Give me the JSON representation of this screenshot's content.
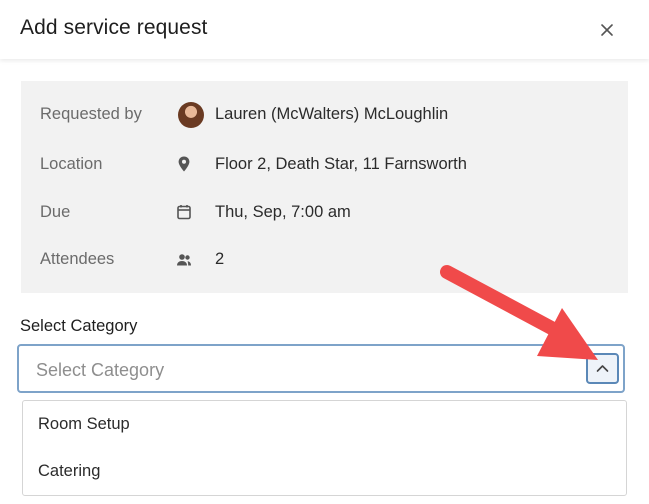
{
  "dialog": {
    "title": "Add service request"
  },
  "details": {
    "requested_by": {
      "label": "Requested by",
      "value": "Lauren (McWalters) McLoughlin"
    },
    "location": {
      "label": "Location",
      "value": "Floor 2, Death Star, 11 Farnsworth",
      "icon": "location-pin-icon"
    },
    "due": {
      "label": "Due",
      "value": "Thu, Sep, 7:00 am",
      "icon": "calendar-icon"
    },
    "attendees": {
      "label": "Attendees",
      "value": "2",
      "icon": "people-icon"
    }
  },
  "category": {
    "label": "Select Category",
    "placeholder": "Select Category",
    "options": [
      "Room Setup",
      "Catering"
    ]
  },
  "colors": {
    "annotation_arrow": "#f04a4a",
    "select_border": "#7ea3c9",
    "panel_bg": "#f2f2f2"
  }
}
